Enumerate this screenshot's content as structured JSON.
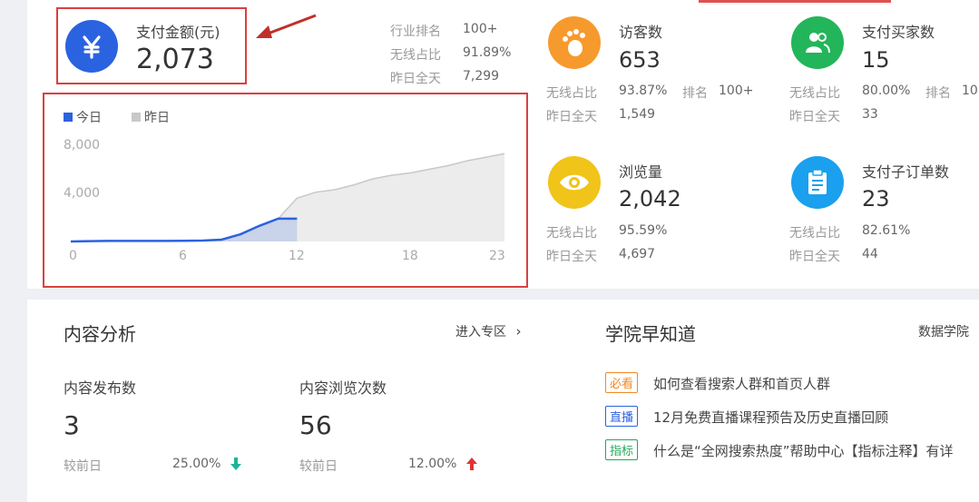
{
  "colors": {
    "pay_icon": "#2b62e0",
    "visitors_icon": "#f79a2d",
    "buyers_icon": "#23b55a",
    "pageviews_icon": "#f0c419",
    "suborders_icon": "#1aa0ee",
    "highlight": "#d94040",
    "today_series": "#2b62e0",
    "yesterday_series": "#c8c8c8",
    "down": "#1fb39b",
    "up": "#e03434"
  },
  "pay": {
    "label": "支付金额(元)",
    "value": "2,073",
    "icon": "yen-icon",
    "rank_label": "行业排名",
    "rank_value": "100+",
    "wireless_label": "无线占比",
    "wireless_value": "91.89%",
    "yesterday_label": "昨日全天",
    "yesterday_value": "7,299"
  },
  "chart": {
    "legend_today": "今日",
    "legend_yesterday": "昨日",
    "y_ticks": [
      "8,000",
      "4,000"
    ],
    "x_ticks": [
      "0",
      "6",
      "12",
      "18",
      "23"
    ]
  },
  "chart_data": {
    "type": "area",
    "x": [
      0,
      1,
      2,
      3,
      4,
      5,
      6,
      7,
      8,
      9,
      10,
      11,
      12,
      13,
      14,
      15,
      16,
      17,
      18,
      19,
      20,
      21,
      22,
      23
    ],
    "series": [
      {
        "name": "今日",
        "values": [
          0,
          30,
          50,
          50,
          50,
          50,
          60,
          80,
          150,
          600,
          1300,
          1900,
          1900
        ]
      },
      {
        "name": "昨日",
        "values": [
          0,
          30,
          50,
          50,
          50,
          50,
          60,
          80,
          150,
          600,
          1300,
          1900,
          3600,
          4100,
          4300,
          4700,
          5200,
          5500,
          5700,
          6000,
          6300,
          6700,
          7000,
          7300
        ]
      }
    ],
    "ylim": [
      0,
      8000
    ],
    "xlim": [
      0,
      23
    ]
  },
  "visitors": {
    "label": "访客数",
    "value": "653",
    "icon": "footprint-icon",
    "wireless_label": "无线占比",
    "wireless_value": "93.87%",
    "rank_label": "排名",
    "rank_value": "100+",
    "yesterday_label": "昨日全天",
    "yesterday_value": "1,549"
  },
  "buyers": {
    "label": "支付买家数",
    "value": "15",
    "icon": "users-icon",
    "wireless_label": "无线占比",
    "wireless_value": "80.00%",
    "rank_label": "排名",
    "rank_value": "10",
    "yesterday_label": "昨日全天",
    "yesterday_value": "33"
  },
  "pageviews": {
    "label": "浏览量",
    "value": "2,042",
    "icon": "eye-icon",
    "wireless_label": "无线占比",
    "wireless_value": "95.59%",
    "yesterday_label": "昨日全天",
    "yesterday_value": "4,697"
  },
  "suborders": {
    "label": "支付子订单数",
    "value": "23",
    "icon": "clipboard-icon",
    "wireless_label": "无线占比",
    "wireless_value": "82.61%",
    "yesterday_label": "昨日全天",
    "yesterday_value": "44"
  },
  "content": {
    "title": "内容分析",
    "enter": "进入专区",
    "publish_label": "内容发布数",
    "publish_value": "3",
    "publish_cmp_label": "较前日",
    "publish_cmp_value": "25.00%",
    "views_label": "内容浏览次数",
    "views_value": "56",
    "views_cmp_label": "较前日",
    "views_cmp_value": "12.00%"
  },
  "academy": {
    "title": "学院早知道",
    "link": "数据学院",
    "items": [
      {
        "tag": "必看",
        "text": "如何查看搜索人群和首页人群",
        "tag_color": "#f08a24"
      },
      {
        "tag": "直播",
        "text": "12月免费直播课程预告及历史直播回顾",
        "tag_color": "#2b62e0"
      },
      {
        "tag": "指标",
        "text": "什么是“全网搜索热度”帮助中心【指标注释】有详",
        "tag_color": "#23a75a"
      }
    ]
  }
}
